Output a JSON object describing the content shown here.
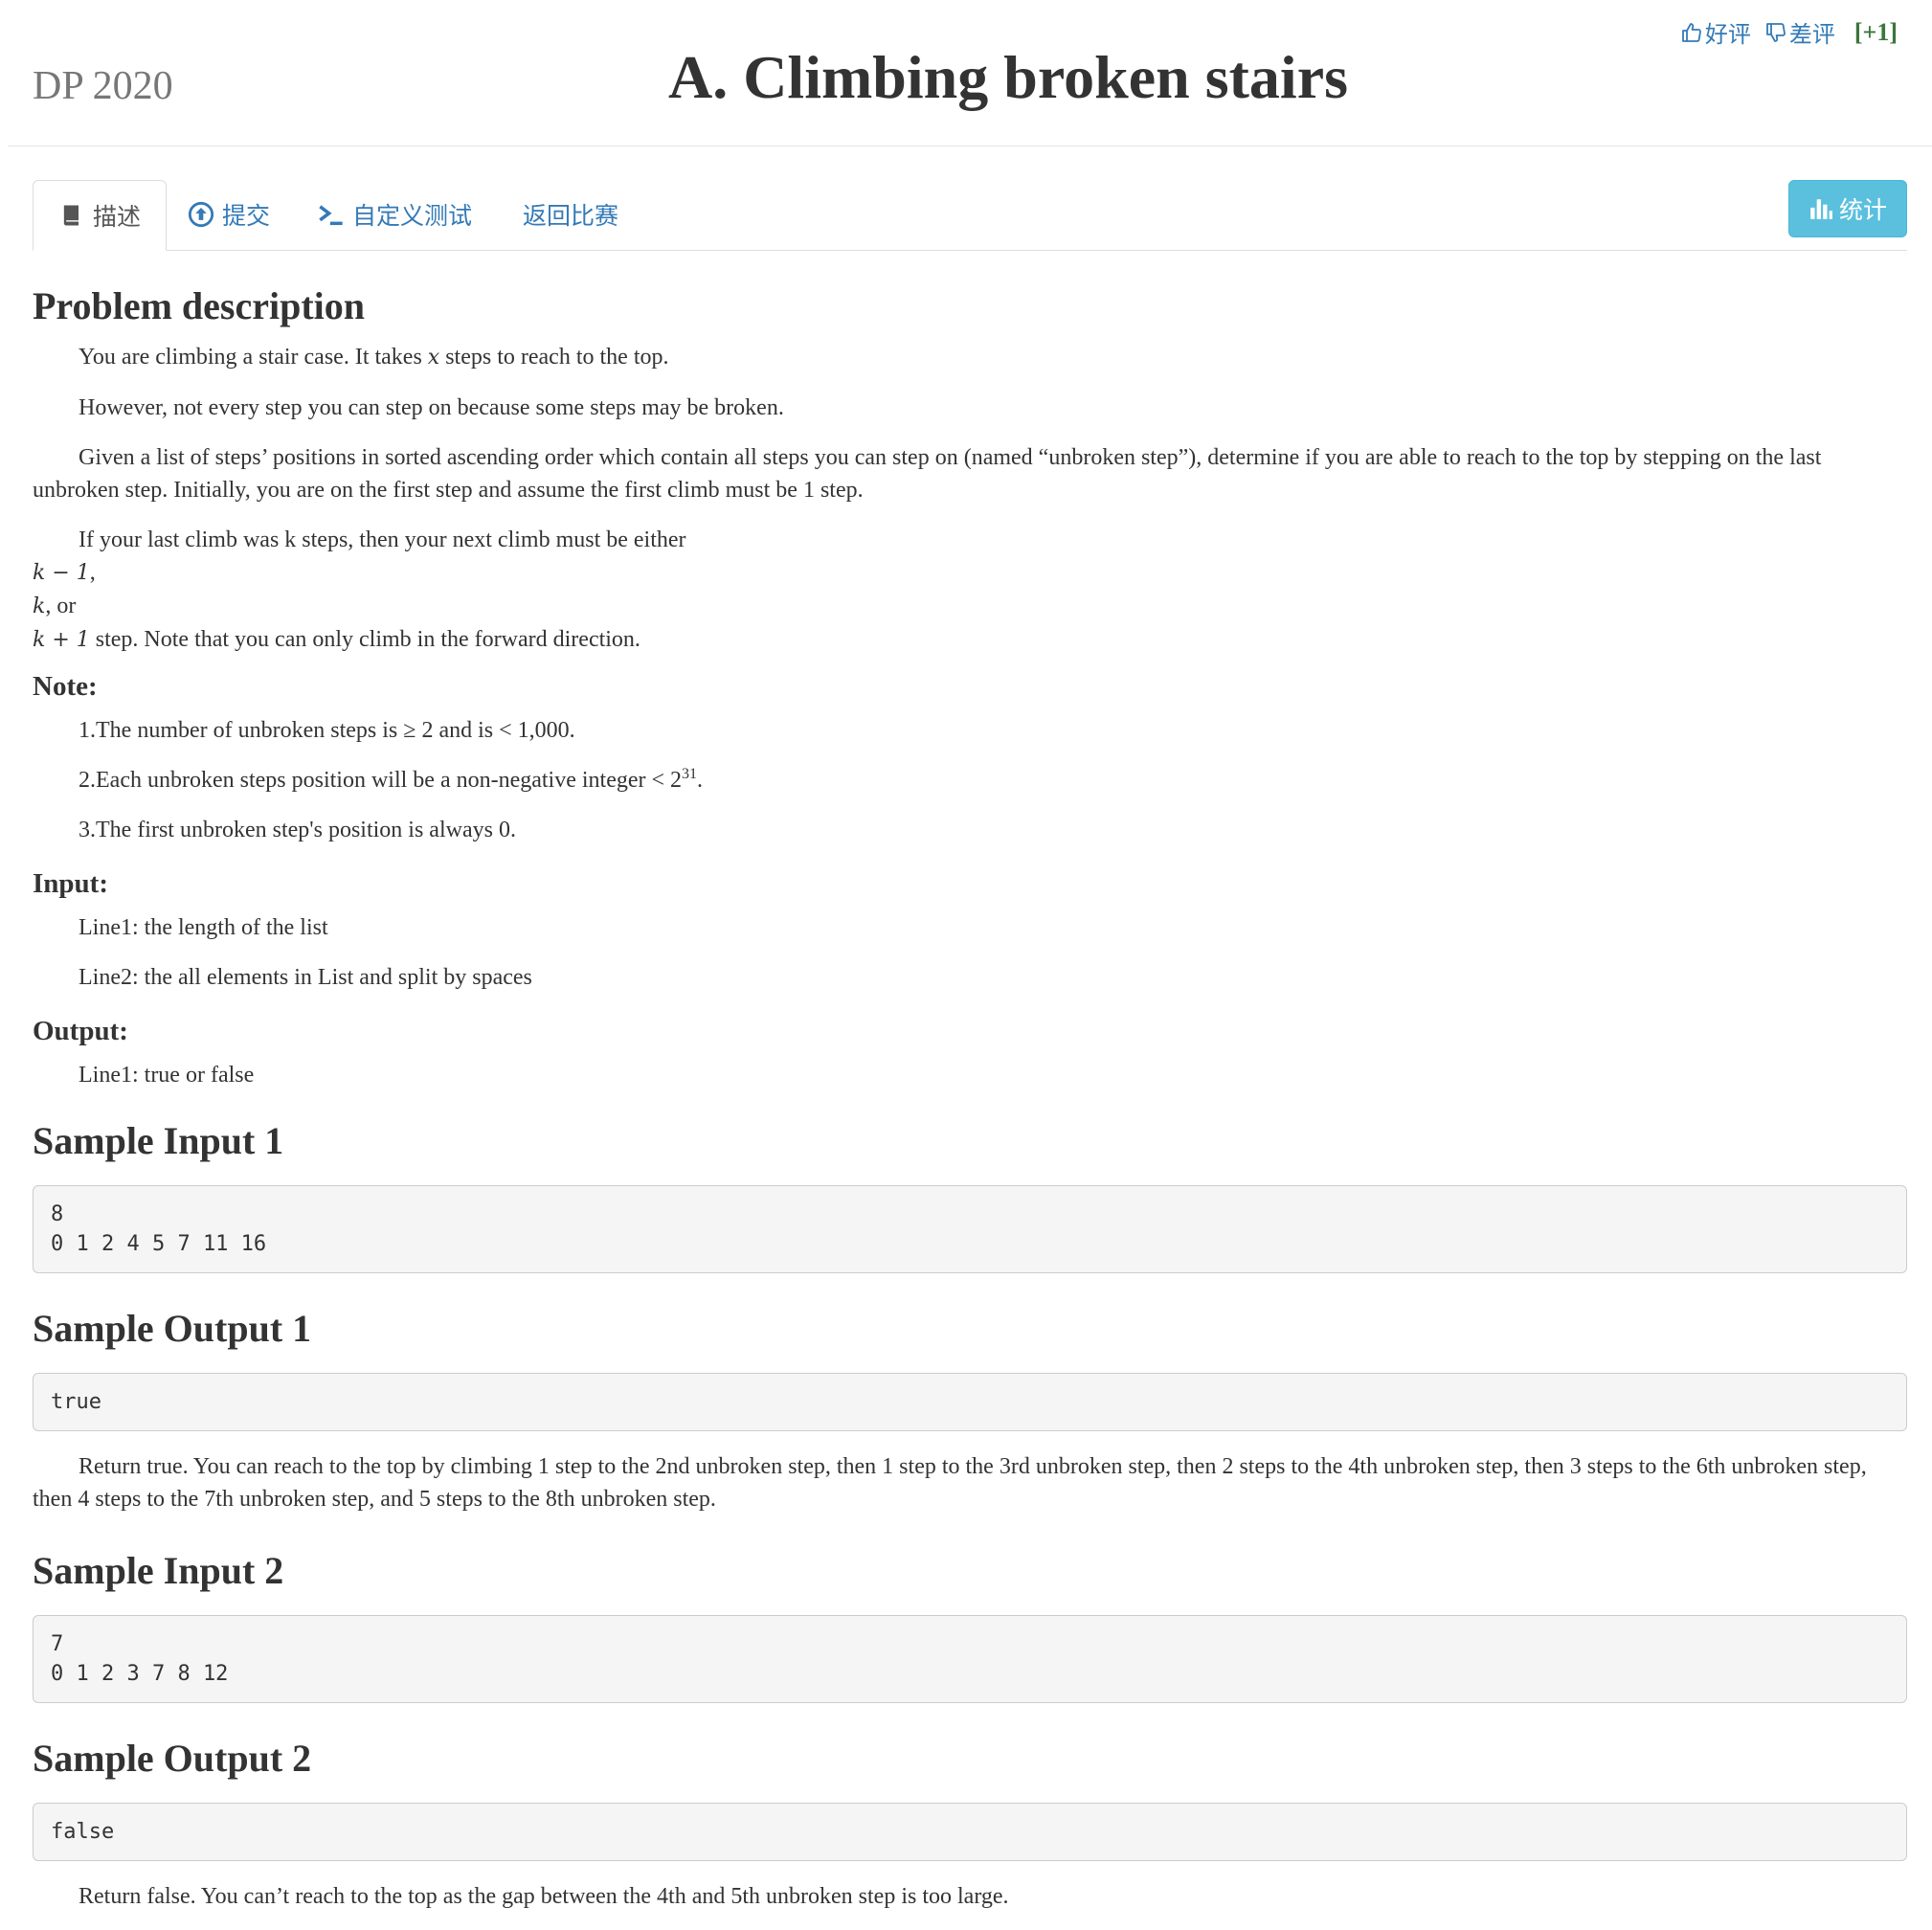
{
  "header": {
    "contest_name": "DP 2020",
    "title": "A. Climbing broken stairs",
    "rating": {
      "good_label": "好评",
      "bad_label": "差评",
      "count": "[+1]"
    }
  },
  "tabs": [
    {
      "label": "描述",
      "icon": "book-icon",
      "active": true
    },
    {
      "label": "提交",
      "icon": "upload-icon",
      "active": false
    },
    {
      "label": "自定义测试",
      "icon": "terminal-icon",
      "active": false
    },
    {
      "label": "返回比赛",
      "icon": "",
      "active": false
    }
  ],
  "stats_button": {
    "label": "统计",
    "icon": "bar-chart-icon"
  },
  "colors": {
    "link": "#337ab7",
    "info_button": "#5bc0de",
    "count_green": "#3c763d"
  },
  "content": {
    "description_heading": "Problem description",
    "desc_p1_before": "You are climbing a stair case. It takes ",
    "desc_p1_var": "x",
    "desc_p1_after": " steps to reach to the top.",
    "desc_p2": "However, not every step you can step on because some steps may be broken.",
    "desc_p3": "Given a list of steps’ positions in sorted ascending order which contain all steps you can step on (named “unbroken step”), determine if you are able to reach to the top by stepping on the last unbroken step. Initially, you are on the first step and assume the first climb must be 1 step.",
    "desc_p4": "If your last climb was k steps, then your next climb must be either",
    "math_line1": "k − 1",
    "math_line1_after": ",",
    "math_line2": "k",
    "math_line2_after": ", or",
    "math_line3": "k + 1",
    "math_line3_after": " step. Note that you can only climb in the forward direction.",
    "note_heading": "Note:",
    "note1": "1.The number of unbroken steps is ≥ 2 and is < 1,000.",
    "note2_before": "2.Each unbroken steps position will be a non-negative integer < 2",
    "note2_sup": "31",
    "note2_after": ".",
    "note3": "3.The first unbroken step's position is always 0.",
    "input_heading": "Input:",
    "input1": "Line1: the length of the list",
    "input2": "Line2: the all elements in List and split by spaces",
    "output_heading": "Output:",
    "output1": "Line1: true or false",
    "sample_input1_heading": "Sample Input 1",
    "sample_input1": "8\n0 1 2 4 5 7 11 16",
    "sample_output1_heading": "Sample Output 1",
    "sample_output1": "true",
    "explain1": "Return true. You can reach to the top by climbing 1 step to the 2nd unbroken step, then 1 step to the 3rd unbroken step, then 2 steps to the 4th unbroken step, then 3 steps to the 6th unbroken step, then 4 steps to the 7th unbroken step, and 5 steps to the 8th unbroken step.",
    "sample_input2_heading": "Sample Input 2",
    "sample_input2": "7\n0 1 2 3 7 8 12",
    "sample_output2_heading": "Sample Output 2",
    "sample_output2": "false",
    "explain2": "Return false. You can’t reach to the top as the gap between the 4th and 5th unbroken step is too large."
  }
}
